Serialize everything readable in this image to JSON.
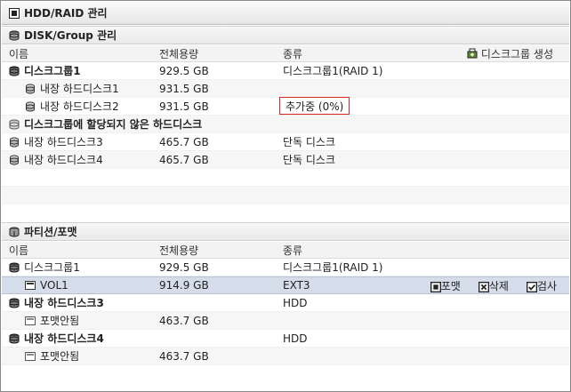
{
  "window": {
    "title": "HDD/RAID 관리"
  },
  "disk_group": {
    "title": "DISK/Group 관리",
    "create_label": "디스크그룹 생성",
    "columns": {
      "name": "이름",
      "size": "전체용량",
      "type": "종류"
    },
    "rows": [
      {
        "name": "디스크그룹1",
        "size": "929.5 GB",
        "type": "디스크그룹1(RAID 1)"
      },
      {
        "name": "내장 하드디스크1",
        "size": "931.5 GB",
        "type": ""
      },
      {
        "name": "내장 하드디스크2",
        "size": "931.5 GB",
        "type": "추가중 (0%)"
      },
      {
        "name": "디스크그룹에 할당되지 않은 하드디스크",
        "size": "",
        "type": ""
      },
      {
        "name": "내장 하드디스크3",
        "size": "465.7 GB",
        "type": "단독 디스크"
      },
      {
        "name": "내장 하드디스크4",
        "size": "465.7 GB",
        "type": "단독 디스크"
      }
    ]
  },
  "partition": {
    "title": "파티션/포맷",
    "columns": {
      "name": "이름",
      "size": "전체용량",
      "type": "종류"
    },
    "rows": [
      {
        "name": "디스크그룹1",
        "size": "929.5 GB",
        "type": "디스크그룹1(RAID 1)"
      },
      {
        "name": "VOL1",
        "size": "914.9 GB",
        "type": "EXT3"
      },
      {
        "name": "내장 하드디스크3",
        "size": "",
        "type": "HDD"
      },
      {
        "name": "포맷안됨",
        "size": "463.7 GB",
        "type": ""
      },
      {
        "name": "내장 하드디스크4",
        "size": "",
        "type": "HDD"
      },
      {
        "name": "포맷안됨",
        "size": "463.7 GB",
        "type": ""
      }
    ],
    "actions": {
      "format": "포맷",
      "delete": "삭제",
      "check": "검사"
    }
  }
}
